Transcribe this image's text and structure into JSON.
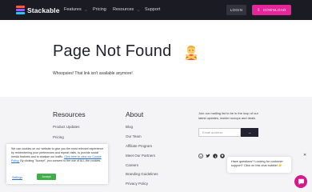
{
  "header": {
    "logo_text": "Stackable",
    "nav": [
      {
        "label": "Features",
        "has_dropdown": true
      },
      {
        "label": "Pricing",
        "has_dropdown": false
      },
      {
        "label": "Resources",
        "has_dropdown": true
      },
      {
        "label": "Support",
        "has_dropdown": false
      }
    ],
    "login_label": "LOGIN",
    "download_label": "DOWNLOAD",
    "download_icon": "download-icon",
    "accent": "#e8249a",
    "background": "#1b1b24"
  },
  "main": {
    "title": "Page Not Found",
    "title_icon": "person-gesturing-no-emoji",
    "subtitle": "Whoopsies! That link isn't available anymore!"
  },
  "footer": {
    "resources": {
      "title": "Resources",
      "links": [
        "Product Updates",
        "Pricing"
      ]
    },
    "about": {
      "title": "About",
      "links": [
        "Blog",
        "Our Team",
        "Affiliate Program",
        "Meet Our Partners",
        "Careers",
        "Branding Guidelines",
        "Privacy Policy"
      ]
    },
    "newsletter": {
      "text": "Join our mailing list to be in the loop of our latest updates, insider scoops and deals",
      "email_placeholder": "Email address",
      "submit_icon": "arrow-right-icon"
    },
    "social_icons": [
      "wordpress-icon",
      "twitter-icon",
      "facebook-icon",
      "github-icon"
    ]
  },
  "cookie": {
    "text_before": "We use cookies on our website to give you the most relevant experience by remembering your preferences and repeat visits, to provide social media features and to analyse our traffic.",
    "link_text": "Click here to view our Cookie Policy.",
    "text_after": "By clicking \"Accept\", you consent to the use of ALL the cookies.",
    "settings_label": "Settings",
    "accept_label": "Accept",
    "accept_color": "#3fae4a"
  },
  "chat": {
    "message": "Have questions? Looking for customer support? Click on this chat bubble! 👉",
    "close_icon": "close-icon",
    "launcher_icon": "chat-icon",
    "launcher_color": "#d6198a"
  }
}
